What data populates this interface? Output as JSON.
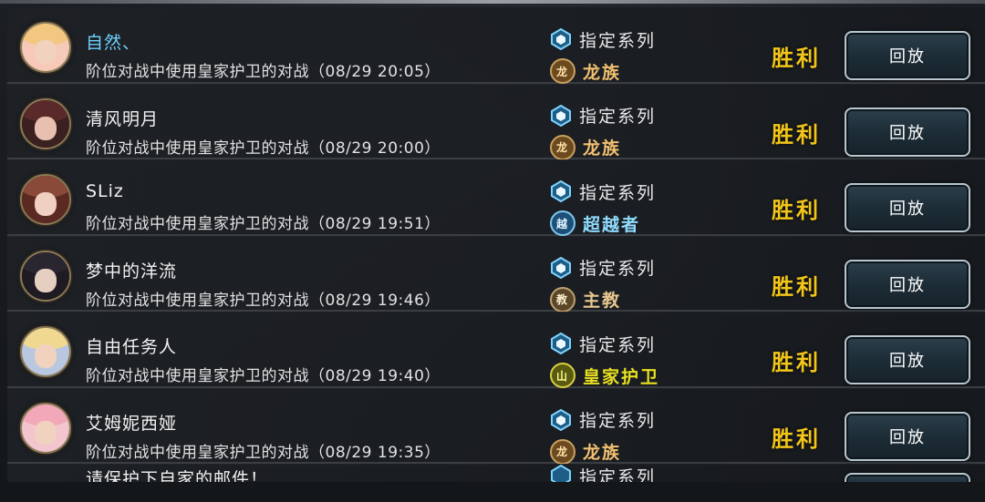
{
  "colors": {
    "result": "#f2c51a",
    "name_highlight": "#6fd0ff",
    "dragon": "#f2c070",
    "transcend": "#8fdcff",
    "bishop": "#e8c890",
    "royal": "#e8e020"
  },
  "battle_history": [
    {
      "player_name": "自然、",
      "highlight": true,
      "description": "阶位对战中使用皇家护卫的对战（08/29 20:05）",
      "format": "指定系列",
      "opponent_class": "龙族",
      "opponent_class_icon": "dragon-icon",
      "result": "胜利",
      "replay_label": "回放"
    },
    {
      "player_name": "清风明月",
      "highlight": false,
      "description": "阶位对战中使用皇家护卫的对战（08/29 20:00）",
      "format": "指定系列",
      "opponent_class": "龙族",
      "opponent_class_icon": "dragon-icon",
      "result": "胜利",
      "replay_label": "回放"
    },
    {
      "player_name": "SLiz",
      "highlight": false,
      "description": "阶位对战中使用皇家护卫的对战（08/29 19:51）",
      "format": "指定系列",
      "opponent_class": "超越者",
      "opponent_class_icon": "transcend-icon",
      "result": "胜利",
      "replay_label": "回放"
    },
    {
      "player_name": "梦中的洋流",
      "highlight": false,
      "description": "阶位对战中使用皇家护卫的对战（08/29 19:46）",
      "format": "指定系列",
      "opponent_class": "主教",
      "opponent_class_icon": "bishop-icon",
      "result": "胜利",
      "replay_label": "回放"
    },
    {
      "player_name": "自由任务人",
      "highlight": false,
      "description": "阶位对战中使用皇家护卫的对战（08/29 19:40）",
      "format": "指定系列",
      "opponent_class": "皇家护卫",
      "opponent_class_icon": "royal-icon",
      "result": "胜利",
      "replay_label": "回放"
    },
    {
      "player_name": "艾姆妮西娅",
      "highlight": false,
      "description": "阶位对战中使用皇家护卫的对战（08/29 19:35）",
      "format": "指定系列",
      "opponent_class": "龙族",
      "opponent_class_icon": "dragon-icon",
      "result": "胜利",
      "replay_label": "回放"
    }
  ],
  "partial_row": {
    "player_name": "请保护下自家的邮件！",
    "format": "指定系列"
  }
}
